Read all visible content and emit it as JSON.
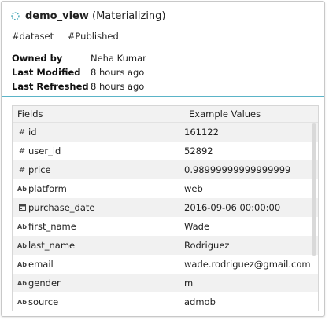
{
  "header": {
    "name": "demo_view",
    "status": "(Materializing)",
    "tags": [
      "#dataset",
      "#Published"
    ]
  },
  "meta": [
    {
      "label": "Owned by",
      "value": "Neha Kumar"
    },
    {
      "label": "Last Modified",
      "value": "8 hours ago"
    },
    {
      "label": "Last Refreshed",
      "value": "8 hours ago"
    }
  ],
  "table": {
    "headers": [
      "Fields",
      "Example Values"
    ],
    "rows": [
      {
        "type": "#",
        "field": "id",
        "value": "161122"
      },
      {
        "type": "#",
        "field": "user_id",
        "value": "52892"
      },
      {
        "type": "#",
        "field": "price",
        "value": "0.98999999999999999"
      },
      {
        "type": "Ab",
        "field": "platform",
        "value": "web"
      },
      {
        "type": "cal",
        "field": "purchase_date",
        "value": "2016-09-06 00:00:00"
      },
      {
        "type": "Ab",
        "field": "first_name",
        "value": "Wade"
      },
      {
        "type": "Ab",
        "field": "last_name",
        "value": "Rodriguez"
      },
      {
        "type": "Ab",
        "field": "email",
        "value": "wade.rodriguez@gmail.com"
      },
      {
        "type": "Ab",
        "field": "gender",
        "value": "m"
      },
      {
        "type": "Ab",
        "field": "source",
        "value": "admob"
      }
    ]
  },
  "colors": {
    "accent": "#5bb4c8",
    "spinner": "#4aa8b8"
  }
}
